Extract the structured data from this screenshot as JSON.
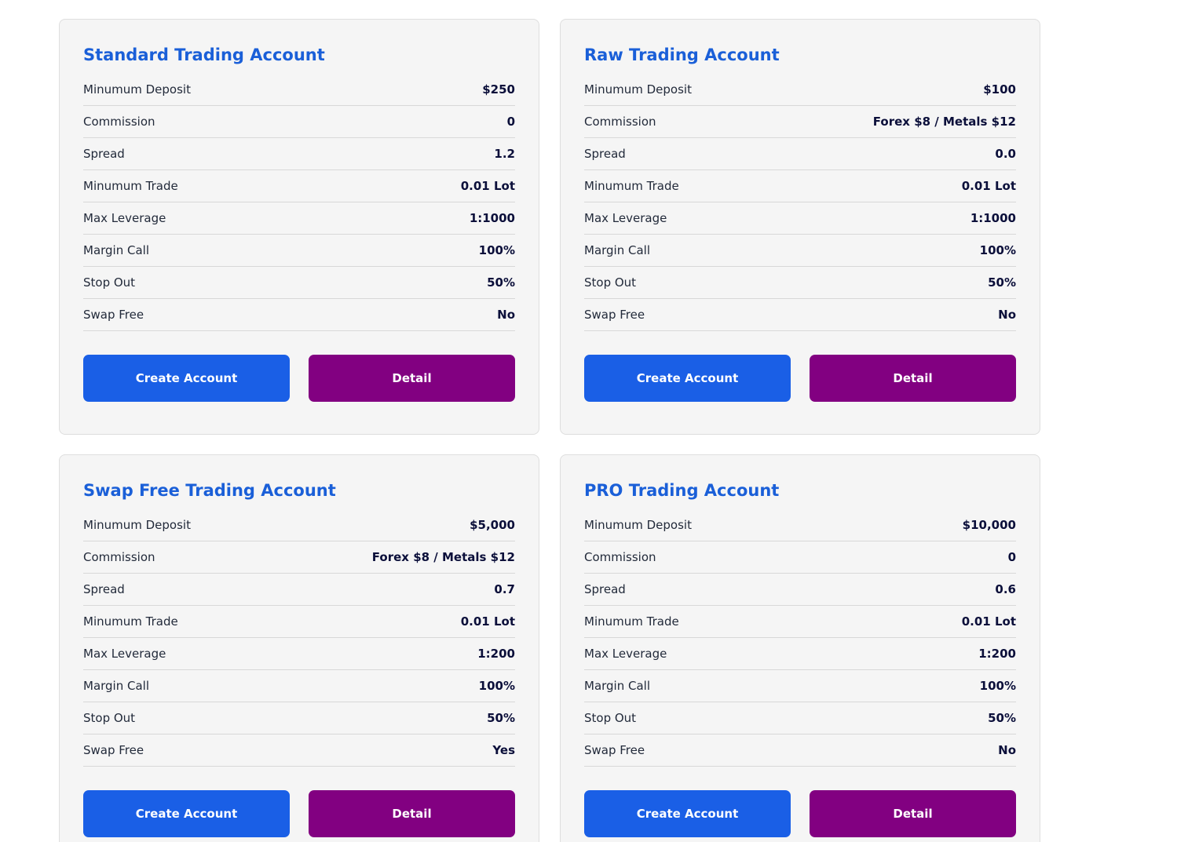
{
  "colors": {
    "title": "#1a5fd8",
    "create_button": "#1a5fe6",
    "detail_button": "#820081",
    "card_background": "#f5f5f5"
  },
  "cards": [
    {
      "title": "Standard Trading Account",
      "rows": [
        {
          "label": "Minumum Deposit",
          "value": "$250"
        },
        {
          "label": "Commission",
          "value": "0"
        },
        {
          "label": "Spread",
          "value": "1.2"
        },
        {
          "label": "Minumum Trade",
          "value": "0.01 Lot"
        },
        {
          "label": "Max Leverage",
          "value": "1:1000"
        },
        {
          "label": "Margin Call",
          "value": "100%"
        },
        {
          "label": "Stop Out",
          "value": "50%"
        },
        {
          "label": "Swap Free",
          "value": "No"
        }
      ],
      "create_label": "Create Account",
      "detail_label": "Detail"
    },
    {
      "title": "Raw Trading Account",
      "rows": [
        {
          "label": "Minumum Deposit",
          "value": "$100"
        },
        {
          "label": "Commission",
          "value": "Forex $8 / Metals $12"
        },
        {
          "label": "Spread",
          "value": "0.0"
        },
        {
          "label": "Minumum Trade",
          "value": "0.01 Lot"
        },
        {
          "label": "Max Leverage",
          "value": "1:1000"
        },
        {
          "label": "Margin Call",
          "value": "100%"
        },
        {
          "label": "Stop Out",
          "value": "50%"
        },
        {
          "label": "Swap Free",
          "value": "No"
        }
      ],
      "create_label": "Create Account",
      "detail_label": "Detail"
    },
    {
      "title": "Swap Free Trading Account",
      "rows": [
        {
          "label": "Minumum Deposit",
          "value": "$5,000"
        },
        {
          "label": "Commission",
          "value": "Forex $8 / Metals $12"
        },
        {
          "label": "Spread",
          "value": "0.7"
        },
        {
          "label": "Minumum Trade",
          "value": "0.01 Lot"
        },
        {
          "label": "Max Leverage",
          "value": "1:200"
        },
        {
          "label": "Margin Call",
          "value": "100%"
        },
        {
          "label": "Stop Out",
          "value": "50%"
        },
        {
          "label": "Swap Free",
          "value": "Yes"
        }
      ],
      "create_label": "Create Account",
      "detail_label": "Detail"
    },
    {
      "title": "PRO Trading Account",
      "rows": [
        {
          "label": "Minumum Deposit",
          "value": "$10,000"
        },
        {
          "label": "Commission",
          "value": "0"
        },
        {
          "label": "Spread",
          "value": "0.6"
        },
        {
          "label": "Minumum Trade",
          "value": "0.01 Lot"
        },
        {
          "label": "Max Leverage",
          "value": "1:200"
        },
        {
          "label": "Margin Call",
          "value": "100%"
        },
        {
          "label": "Stop Out",
          "value": "50%"
        },
        {
          "label": "Swap Free",
          "value": "No"
        }
      ],
      "create_label": "Create Account",
      "detail_label": "Detail"
    }
  ]
}
